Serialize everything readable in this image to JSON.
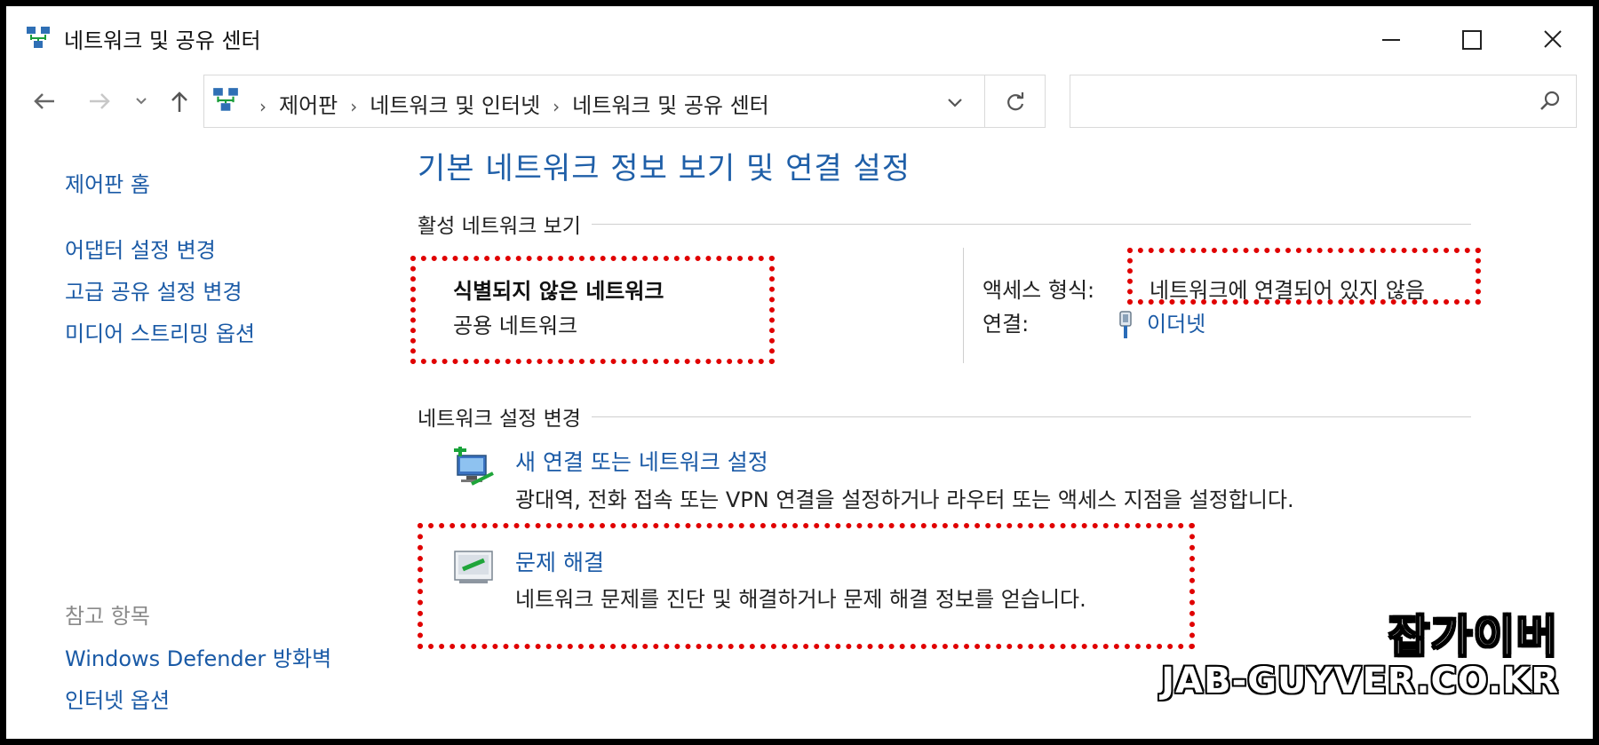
{
  "window": {
    "title": "네트워크 및 공유 센터",
    "icon": "network-icon"
  },
  "address_bar": {
    "breadcrumbs": [
      "제어판",
      "네트워크 및 인터넷",
      "네트워크 및 공유 센터"
    ],
    "search_placeholder": ""
  },
  "sidebar": {
    "home": "제어판 홈",
    "links": [
      "어댑터 설정 변경",
      "고급 공유 설정 변경",
      "미디어 스트리밍 옵션"
    ],
    "see_also_heading": "참고 항목",
    "see_also": [
      "Windows Defender 방화벽",
      "인터넷 옵션"
    ]
  },
  "main": {
    "title": "기본 네트워크 정보 보기 및 연결 설정",
    "active_section": "활성 네트워크 보기",
    "network": {
      "name": "식별되지 않은 네트워크",
      "type": "공용 네트워크",
      "access_label": "액세스 형식:",
      "access_value": "네트워크에 연결되어 있지 않음",
      "connection_label": "연결:",
      "connection_value": "이더넷"
    },
    "change_section": "네트워크 설정 변경",
    "tasks": [
      {
        "label": "새 연결 또는 네트워크 설정",
        "description": "광대역, 전화 접속 또는 VPN 연결을 설정하거나 라우터 또는 액세스 지점을 설정합니다.",
        "icon": "new-connection-icon"
      },
      {
        "label": "문제 해결",
        "description": "네트워크 문제를 진단 및 해결하거나 문제 해결 정보를 얻습니다.",
        "icon": "troubleshoot-icon"
      }
    ]
  },
  "watermark": {
    "title": "잡가이버",
    "url": "JAB-GUYVER.CO.KR"
  },
  "colors": {
    "link": "#1a5aa6",
    "title": "#1f5fa8",
    "highlight": "#e00000"
  }
}
